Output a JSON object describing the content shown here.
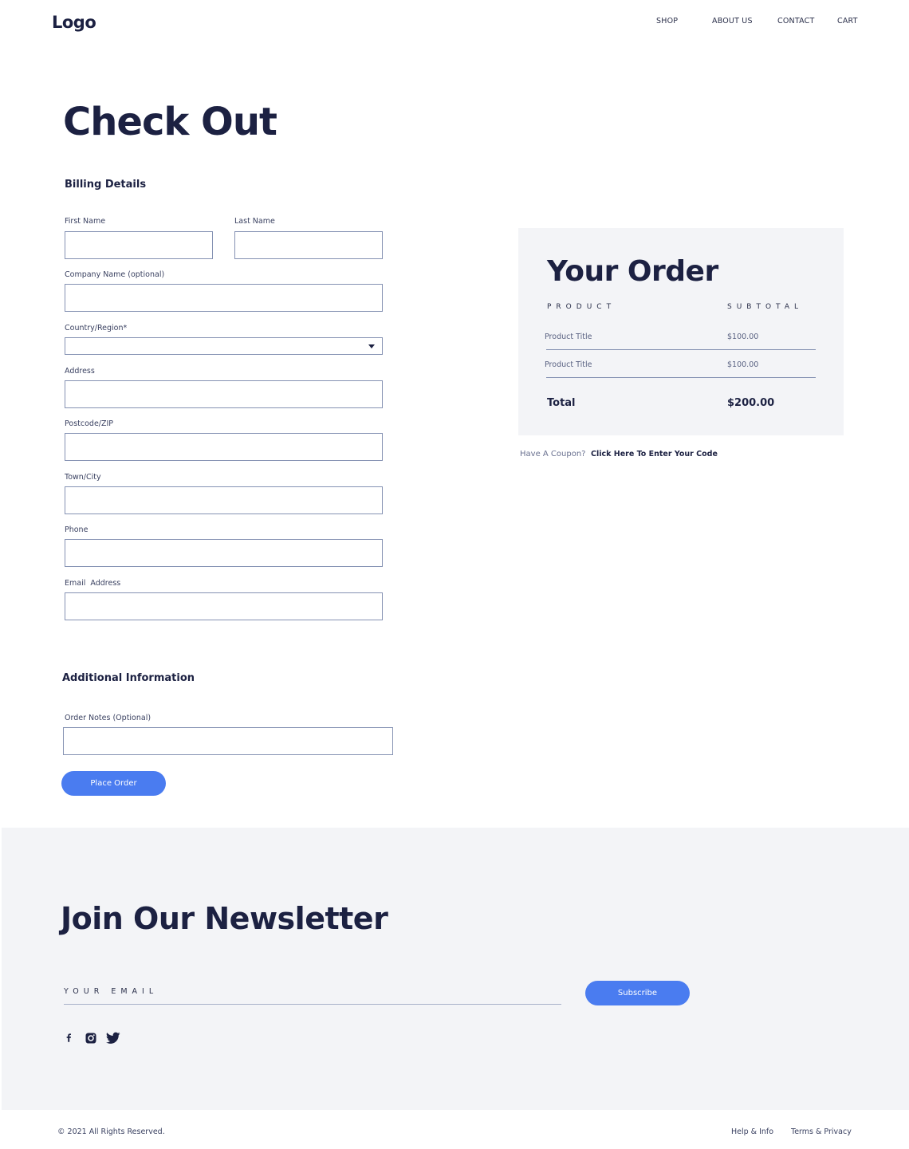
{
  "header": {
    "logo": "Logo",
    "nav": [
      "SHOP",
      "ABOUT US",
      "CONTACT",
      "CART"
    ]
  },
  "page_title": "Check Out",
  "billing": {
    "heading": "Billing Details",
    "fields": {
      "first_name": {
        "label": "First Name",
        "value": ""
      },
      "last_name": {
        "label": "Last Name",
        "value": ""
      },
      "company": {
        "label": "Company Name (optional)",
        "value": ""
      },
      "country": {
        "label": "Country/Region*",
        "value": ""
      },
      "address": {
        "label": "Address",
        "value": ""
      },
      "postcode": {
        "label": "Postcode/ZIP",
        "value": ""
      },
      "town": {
        "label": "Town/City",
        "value": ""
      },
      "phone": {
        "label": "Phone",
        "value": ""
      },
      "email": {
        "label": "Email  Address",
        "value": ""
      }
    }
  },
  "additional": {
    "heading": "Additional Information",
    "notes_label": "Order Notes (Optional)",
    "notes_value": ""
  },
  "place_order_label": "Place Order",
  "order": {
    "title": "Your Order",
    "col_product": "PRODUCT",
    "col_subtotal": "SUBTOTAL",
    "items": [
      {
        "name": "Product Title",
        "price": "$100.00"
      },
      {
        "name": "Product Title",
        "price": "$100.00"
      }
    ],
    "total_label": "Total",
    "total_value": "$200.00"
  },
  "coupon": {
    "question": "Have A Coupon?",
    "link": "Click Here To Enter Your Code"
  },
  "newsletter": {
    "title": "Join Our Newsletter",
    "email_placeholder": "YOUR EMAIL",
    "subscribe_label": "Subscribe",
    "social_icons": [
      "facebook-icon",
      "instagram-icon",
      "twitter-icon"
    ]
  },
  "footer": {
    "copyright": "© 2021 All Rights Reserved.",
    "links": [
      "Help & Info",
      "Terms & Privacy"
    ]
  },
  "colors": {
    "primary": "#4a7cf0",
    "heading": "#1c2142",
    "panel_bg": "#f3f4f7",
    "border": "#8592b3"
  }
}
